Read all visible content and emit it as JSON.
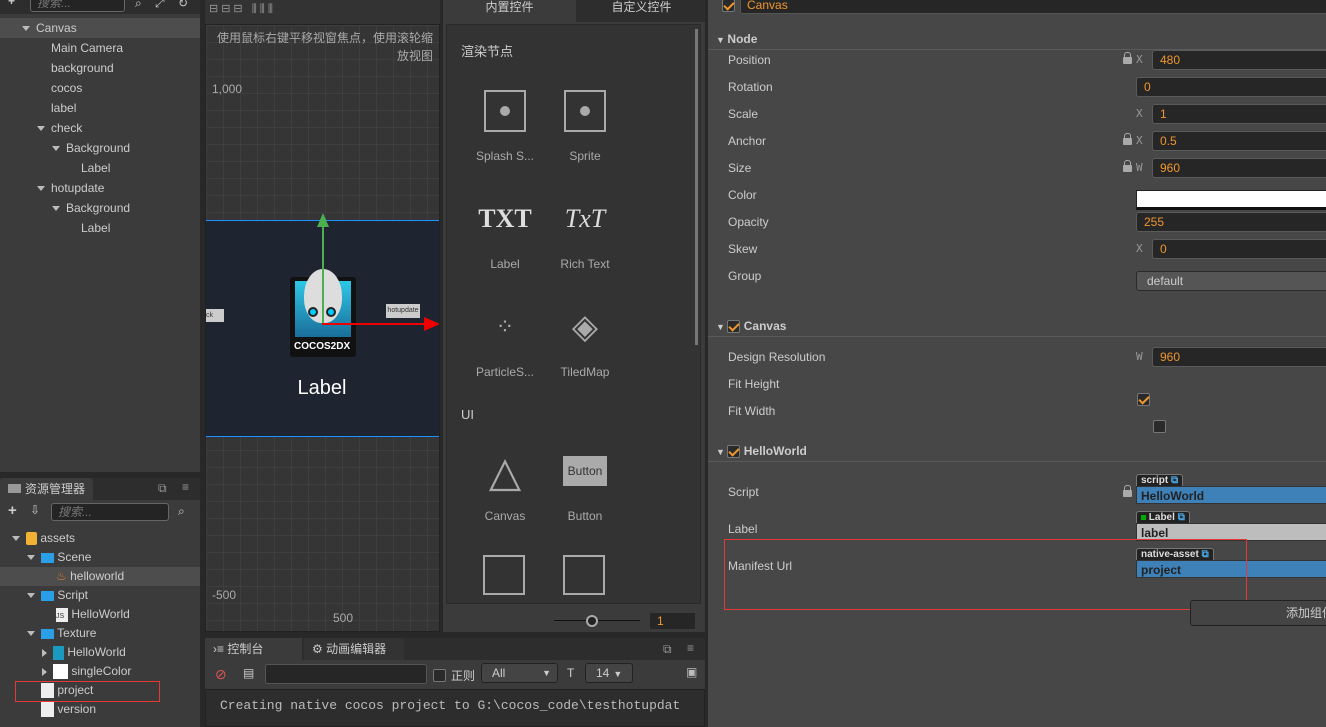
{
  "hierarchy": {
    "search_placeholder": "搜索...",
    "nodes": [
      {
        "label": "Canvas",
        "depth": 0,
        "expanded": true,
        "selected": true
      },
      {
        "label": "Main Camera",
        "depth": 1
      },
      {
        "label": "background",
        "depth": 1
      },
      {
        "label": "cocos",
        "depth": 1
      },
      {
        "label": "label",
        "depth": 1
      },
      {
        "label": "check",
        "depth": 1,
        "expanded": true
      },
      {
        "label": "Background",
        "depth": 2,
        "expanded": true
      },
      {
        "label": "Label",
        "depth": 3
      },
      {
        "label": "hotupdate",
        "depth": 1,
        "expanded": true
      },
      {
        "label": "Background",
        "depth": 2,
        "expanded": true
      },
      {
        "label": "Label",
        "depth": 3
      }
    ]
  },
  "assets": {
    "title": "资源管理器",
    "search_placeholder": "搜索...",
    "items": [
      {
        "label": "assets",
        "depth": 0,
        "icon": "assets-db-icon",
        "expanded": true
      },
      {
        "label": "Scene",
        "depth": 1,
        "icon": "folder-icon",
        "expanded": true
      },
      {
        "label": "helloworld",
        "depth": 2,
        "icon": "scene-fire-icon",
        "selected": true
      },
      {
        "label": "Script",
        "depth": 1,
        "icon": "folder-icon",
        "expanded": true
      },
      {
        "label": "HelloWorld",
        "depth": 2,
        "icon": "js-file-icon"
      },
      {
        "label": "Texture",
        "depth": 1,
        "icon": "folder-icon",
        "expanded": true
      },
      {
        "label": "HelloWorld",
        "depth": 2,
        "icon": "texture-icon",
        "collapsed": true
      },
      {
        "label": "singleColor",
        "depth": 2,
        "icon": "white-texture-icon",
        "collapsed": true
      },
      {
        "label": "project",
        "depth": 1,
        "icon": "file-icon",
        "highlighted": true
      },
      {
        "label": "version",
        "depth": 1,
        "icon": "file-icon"
      }
    ]
  },
  "scene": {
    "hint": "使用鼠标右键平移视窗焦点，使用滚轮缩放视图",
    "y_top": "1,000",
    "y_bottom": "-500",
    "x_label": "500",
    "canvas_label": "Label",
    "btn_check": "ck",
    "btn_hotupdate": "hotupdate"
  },
  "widgets": {
    "tabs": [
      "内置控件",
      "自定义控件"
    ],
    "section_render": "渲染节点",
    "section_ui": "UI",
    "items": [
      {
        "label": "Splash S...",
        "icon": "splash-sprite-icon"
      },
      {
        "label": "Sprite",
        "icon": "sprite-icon"
      },
      {
        "label": "Label",
        "icon": "label-txt-icon",
        "glyph": "TXT"
      },
      {
        "label": "Rich Text",
        "icon": "richtext-icon",
        "glyph": "TxT"
      },
      {
        "label": "ParticleS...",
        "icon": "particle-icon"
      },
      {
        "label": "TiledMap",
        "icon": "tiledmap-icon"
      },
      {
        "label": "Canvas",
        "icon": "canvas-icon"
      },
      {
        "label": "Button",
        "icon": "button-icon",
        "glyph": "Button"
      }
    ],
    "zoom_value": "1"
  },
  "console": {
    "tabs": [
      "控制台",
      "动画编辑器"
    ],
    "regex_label": "正则",
    "level": "All",
    "font_size": "14",
    "log": "Creating native cocos project to G:\\cocos_code\\testhotupdat"
  },
  "inspector": {
    "node_name": "Canvas",
    "node_section": "Node",
    "props": [
      {
        "label": "Position",
        "axis": "X",
        "value": "480",
        "locked": true
      },
      {
        "label": "Rotation",
        "value": "0"
      },
      {
        "label": "Scale",
        "axis": "X",
        "value": "1"
      },
      {
        "label": "Anchor",
        "axis": "X",
        "value": "0.5",
        "locked": true
      },
      {
        "label": "Size",
        "axis": "W",
        "value": "960",
        "locked": true
      },
      {
        "label": "Color",
        "color": "#ffffff"
      },
      {
        "label": "Opacity",
        "value": "255"
      },
      {
        "label": "Skew",
        "axis": "X",
        "value": "0"
      },
      {
        "label": "Group",
        "select": "default"
      }
    ],
    "canvas_section": "Canvas",
    "design_resolution_label": "Design Resolution",
    "design_axis": "W",
    "design_value": "960",
    "fit_height_label": "Fit Height",
    "fit_height": true,
    "fit_width_label": "Fit Width",
    "fit_width": false,
    "helloworld_section": "HelloWorld",
    "script_label": "Script",
    "script_tag": "script",
    "script_value": "HelloWorld",
    "label_label": "Label",
    "label_tag": "Label",
    "label_value": "label",
    "manifest_label": "Manifest Url",
    "manifest_tag": "native-asset",
    "manifest_value": "project",
    "add_component": "添加组件"
  },
  "colors": {
    "accent": "#f0962e",
    "asset_blue": "#3e80b8",
    "highlight_red": "#e53935",
    "canvas_bg": "#1e2530"
  }
}
